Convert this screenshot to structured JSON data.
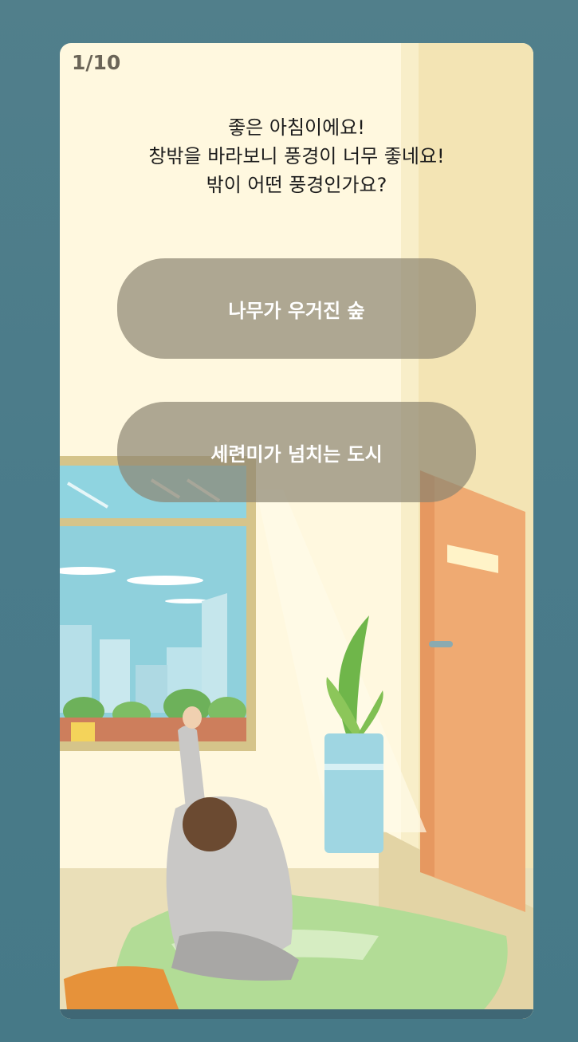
{
  "quiz": {
    "progress": "1/10",
    "question_lines": [
      "좋은 아침이에요!",
      "창밖을 바라보니 풍경이 너무 좋네요!",
      "밖이 어떤 풍경인가요?"
    ],
    "options": [
      "나무가 우거진 숲",
      "세련미가 넘치는 도시"
    ]
  },
  "colors": {
    "background": "#4a7b8a",
    "card": "#fff8df",
    "button": "#8c8470"
  }
}
